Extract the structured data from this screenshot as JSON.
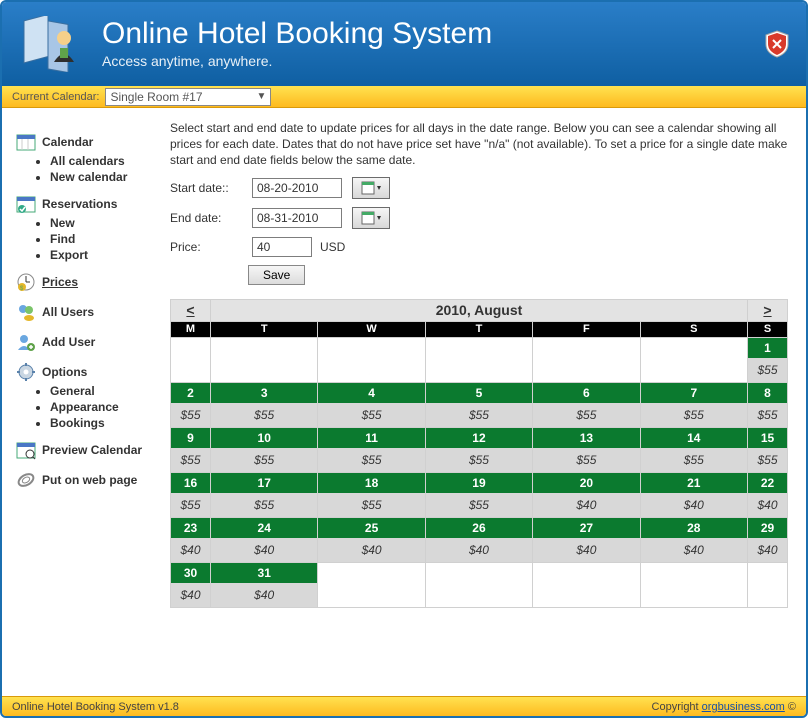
{
  "header": {
    "title": "Online Hotel Booking System",
    "subtitle": "Access anytime, anywhere."
  },
  "bar": {
    "label": "Current Calendar:",
    "selected": "Single Room #17"
  },
  "sidebar": {
    "calendar": {
      "label": "Calendar",
      "items": [
        "All calendars",
        "New calendar"
      ]
    },
    "reservations": {
      "label": "Reservations",
      "items": [
        "New",
        "Find",
        "Export"
      ]
    },
    "prices": {
      "label": "Prices"
    },
    "allusers": {
      "label": "All Users"
    },
    "adduser": {
      "label": "Add User"
    },
    "options": {
      "label": "Options",
      "items": [
        "General",
        "Appearance",
        "Bookings"
      ]
    },
    "preview": {
      "label": "Preview Calendar"
    },
    "webpage": {
      "label": "Put on web page"
    }
  },
  "main": {
    "instructions": "Select start and end date to update prices for all days in the date range. Below you can see a calendar showing all prices for each date. Dates that do not have price set have \"n/a\" (not available). To set a price for a single date make start and end date fields below the same date.",
    "start_label": "Start date::",
    "start_value": "08-20-2010",
    "end_label": "End date:",
    "end_value": "08-31-2010",
    "price_label": "Price:",
    "price_value": "40",
    "currency": "USD",
    "save": "Save"
  },
  "calendar": {
    "prev": "<",
    "next": ">",
    "title": "2010, August",
    "dow": [
      "M",
      "T",
      "W",
      "T",
      "F",
      "S",
      "S"
    ],
    "weeks": [
      [
        {
          "empty": true
        },
        {
          "empty": true
        },
        {
          "empty": true
        },
        {
          "empty": true
        },
        {
          "empty": true
        },
        {
          "empty": true
        },
        {
          "d": "1",
          "p": "$55"
        }
      ],
      [
        {
          "d": "2",
          "p": "$55"
        },
        {
          "d": "3",
          "p": "$55"
        },
        {
          "d": "4",
          "p": "$55"
        },
        {
          "d": "5",
          "p": "$55"
        },
        {
          "d": "6",
          "p": "$55"
        },
        {
          "d": "7",
          "p": "$55"
        },
        {
          "d": "8",
          "p": "$55"
        }
      ],
      [
        {
          "d": "9",
          "p": "$55"
        },
        {
          "d": "10",
          "p": "$55"
        },
        {
          "d": "11",
          "p": "$55"
        },
        {
          "d": "12",
          "p": "$55"
        },
        {
          "d": "13",
          "p": "$55"
        },
        {
          "d": "14",
          "p": "$55"
        },
        {
          "d": "15",
          "p": "$55"
        }
      ],
      [
        {
          "d": "16",
          "p": "$55"
        },
        {
          "d": "17",
          "p": "$55"
        },
        {
          "d": "18",
          "p": "$55"
        },
        {
          "d": "19",
          "p": "$55"
        },
        {
          "d": "20",
          "p": "$40"
        },
        {
          "d": "21",
          "p": "$40"
        },
        {
          "d": "22",
          "p": "$40"
        }
      ],
      [
        {
          "d": "23",
          "p": "$40"
        },
        {
          "d": "24",
          "p": "$40"
        },
        {
          "d": "25",
          "p": "$40"
        },
        {
          "d": "26",
          "p": "$40"
        },
        {
          "d": "27",
          "p": "$40"
        },
        {
          "d": "28",
          "p": "$40"
        },
        {
          "d": "29",
          "p": "$40"
        }
      ],
      [
        {
          "d": "30",
          "p": "$40"
        },
        {
          "d": "31",
          "p": "$40"
        },
        {
          "empty": true
        },
        {
          "empty": true
        },
        {
          "empty": true
        },
        {
          "empty": true
        },
        {
          "empty": true
        }
      ]
    ]
  },
  "footer": {
    "left": "Online Hotel Booking System v1.8",
    "right_pre": "Copyright ",
    "right_link": "orgbusiness.com",
    "right_post": " ©"
  }
}
